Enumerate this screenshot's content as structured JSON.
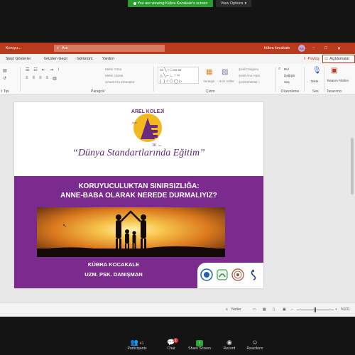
{
  "zoom": {
    "viewing_banner": "You are viewing Kübra Kocakale's screen",
    "view_options": "View Options",
    "toolbar": {
      "participants_label": "Participants",
      "participants_count": "41",
      "chat_label": "Chat",
      "chat_badge": "1",
      "share_label": "Share Screen",
      "record_label": "Record",
      "reactions_label": "Reactions"
    }
  },
  "powerpoint": {
    "title_filename": "Koruyu...",
    "search_placeholder": "Ara",
    "user_name": "kübra kocakale",
    "user_initials": "KK",
    "menu": {
      "slayt_gosterisi": "Slayt Gösterisi",
      "gozden_gecir": "Gözden Geçir",
      "gorunum": "Görünüm",
      "yardim": "Yardım",
      "paylas": "Paylaş",
      "aciklamalar": "Açıklamalar"
    },
    "ribbon": {
      "groups": {
        "slayt_tipi": "t Tipi",
        "paragraf": "Paragraf",
        "cizim": "Çizim",
        "duzenleme": "Düzenleme",
        "ses": "Ses",
        "tasarimci": "Tasarımcı"
      },
      "metin_yonu": "Metin Yönü",
      "metni_hizala": "Metni Hizala",
      "smartarta_donustur": "SmartArt'a Dönüştür",
      "yerlestir": "Yerleştir",
      "hizli_stiller": "Hızlı Stiller",
      "sekil_dolgusu": "Şekil Dolgusu",
      "sekil_ana_hatti": "Şekil Ana Hattı",
      "sekil_efektleri": "Şekil Efektleri",
      "bul": "Bul",
      "degistir": "Değiştir",
      "sec": "Seç",
      "dikte": "Dikte",
      "tasarim_fikirleri": "Tasarım Fikirleri"
    },
    "slide": {
      "logo_text": "AREL KOLEJİ",
      "logo_year": "1986",
      "logo_anniversary": "30",
      "logo_anniversary_suffix": "ncu",
      "tagline": "“Dünya Standartlarında Eğitim”",
      "title_line1": "KORUYUCULUKTAN SINIRSIZLIĞA:",
      "title_line2": "ANNE-BABA OLARAK NEREDE DURMALIYIZ?",
      "presenter_name": "KÜBRA KOCAKALE",
      "presenter_title": "UZM. PSK. DANIŞMAN"
    },
    "status": {
      "notlar": "Notlar",
      "zoom_level": "%101"
    }
  },
  "colors": {
    "ppt_accent": "#b83b1e",
    "slide_purple": "#7b2b8e",
    "zoom_green": "#2b9c2f"
  }
}
